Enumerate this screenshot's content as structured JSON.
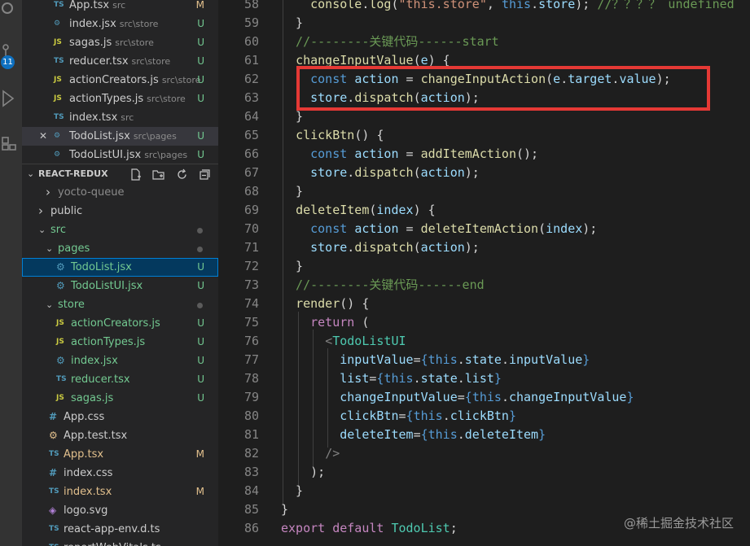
{
  "explorer": {
    "open_editors": [
      {
        "type": "TS",
        "name": "App.tsx",
        "path": "src",
        "status": "M",
        "type_color": "#519aba"
      },
      {
        "type": "⚙",
        "name": "index.jsx",
        "path": "src\\store",
        "status": "U",
        "type_color": "#519aba"
      },
      {
        "type": "JS",
        "name": "sagas.js",
        "path": "src\\store",
        "status": "U",
        "type_color": "#cbcb41"
      },
      {
        "type": "TS",
        "name": "reducer.tsx",
        "path": "src\\store",
        "status": "U",
        "type_color": "#519aba"
      },
      {
        "type": "JS",
        "name": "actionCreators.js",
        "path": "src\\store",
        "status": "U",
        "type_color": "#cbcb41"
      },
      {
        "type": "JS",
        "name": "actionTypes.js",
        "path": "src\\store",
        "status": "U",
        "type_color": "#cbcb41"
      },
      {
        "type": "TS",
        "name": "index.tsx",
        "path": "src",
        "status": "",
        "type_color": "#519aba"
      },
      {
        "type": "⚙",
        "name": "TodoList.jsx",
        "path": "src\\pages",
        "status": "U",
        "type_color": "#519aba",
        "close": "✕"
      },
      {
        "type": "⚙",
        "name": "TodoListUI.jsx",
        "path": "src\\pages",
        "status": "U",
        "type_color": "#519aba"
      }
    ],
    "section_title": "REACT-REDUX",
    "tree": [
      {
        "depth": 1,
        "chev": "›",
        "type": "",
        "name": "yocto-queue",
        "status": "",
        "dim": true
      },
      {
        "depth": 0,
        "chev": "›",
        "type": "",
        "name": "public",
        "status": ""
      },
      {
        "depth": 0,
        "chev": "⌄",
        "type": "",
        "name": "src",
        "status": "dot",
        "dot_color": "#73c991"
      },
      {
        "depth": 1,
        "chev": "⌄",
        "type": "",
        "name": "pages",
        "status": "dot",
        "dot_color": "#73c991"
      },
      {
        "depth": 2,
        "type": "⚙",
        "name": "TodoList.jsx",
        "status": "U",
        "selected": true,
        "type_color": "#519aba"
      },
      {
        "depth": 2,
        "type": "⚙",
        "name": "TodoListUI.jsx",
        "status": "U",
        "type_color": "#519aba"
      },
      {
        "depth": 1,
        "chev": "⌄",
        "type": "",
        "name": "store",
        "status": "dot",
        "dot_color": "#73c991"
      },
      {
        "depth": 2,
        "type": "JS",
        "name": "actionCreators.js",
        "status": "U",
        "type_color": "#cbcb41"
      },
      {
        "depth": 2,
        "type": "JS",
        "name": "actionTypes.js",
        "status": "U",
        "type_color": "#cbcb41"
      },
      {
        "depth": 2,
        "type": "⚙",
        "name": "index.jsx",
        "status": "U",
        "type_color": "#519aba"
      },
      {
        "depth": 2,
        "type": "TS",
        "name": "reducer.tsx",
        "status": "U",
        "type_color": "#519aba"
      },
      {
        "depth": 2,
        "type": "JS",
        "name": "sagas.js",
        "status": "U",
        "type_color": "#cbcb41"
      },
      {
        "depth": 1,
        "type": "#",
        "name": "App.css",
        "status": "",
        "type_color": "#519aba"
      },
      {
        "depth": 1,
        "type": "⚙",
        "name": "App.test.tsx",
        "status": "",
        "type_color": "#e2c08d"
      },
      {
        "depth": 1,
        "type": "TS",
        "name": "App.tsx",
        "status": "M",
        "type_color": "#519aba"
      },
      {
        "depth": 1,
        "type": "#",
        "name": "index.css",
        "status": "",
        "type_color": "#519aba"
      },
      {
        "depth": 1,
        "type": "TS",
        "name": "index.tsx",
        "status": "M",
        "type_color": "#519aba"
      },
      {
        "depth": 1,
        "type": "◈",
        "name": "logo.svg",
        "status": "",
        "type_color": "#b180d7"
      },
      {
        "depth": 1,
        "type": "TS",
        "name": "react-app-env.d.ts",
        "status": "",
        "type_color": "#519aba"
      },
      {
        "depth": 1,
        "type": "TS",
        "name": "reportWebVitals.ts",
        "status": "",
        "type_color": "#519aba"
      }
    ],
    "activity_badge": "11"
  },
  "editor": {
    "lines": [
      {
        "n": "58",
        "tokens": [
          [
            "    ",
            "p"
          ],
          [
            "console",
            "y"
          ],
          [
            ".",
            "p"
          ],
          [
            "log",
            "y"
          ],
          [
            "(",
            "p"
          ],
          [
            "\"this.store\"",
            "s"
          ],
          [
            ", ",
            "p"
          ],
          [
            "this",
            "k"
          ],
          [
            ".",
            "p"
          ],
          [
            "store",
            "v"
          ],
          [
            "); ",
            "p"
          ],
          [
            "//？？？？ undefined",
            "c"
          ]
        ]
      },
      {
        "n": "59",
        "tokens": [
          [
            "  }",
            "p"
          ]
        ]
      },
      {
        "n": "60",
        "tokens": [
          [
            "  //--------关键代码------start",
            "c"
          ]
        ]
      },
      {
        "n": "61",
        "tokens": [
          [
            "  ",
            "p"
          ],
          [
            "changeInputValue",
            "y"
          ],
          [
            "(",
            "p"
          ],
          [
            "e",
            "v"
          ],
          [
            ") {",
            "p"
          ]
        ]
      },
      {
        "n": "62",
        "tokens": [
          [
            "    ",
            "p"
          ],
          [
            "const ",
            "k"
          ],
          [
            "action",
            "v"
          ],
          [
            " = ",
            "p"
          ],
          [
            "changeInputAction",
            "y"
          ],
          [
            "(",
            "p"
          ],
          [
            "e",
            "v"
          ],
          [
            ".",
            "p"
          ],
          [
            "target",
            "v"
          ],
          [
            ".",
            "p"
          ],
          [
            "value",
            "v"
          ],
          [
            ");",
            "p"
          ]
        ]
      },
      {
        "n": "63",
        "tokens": [
          [
            "    ",
            "p"
          ],
          [
            "store",
            "v"
          ],
          [
            ".",
            "p"
          ],
          [
            "dispatch",
            "y"
          ],
          [
            "(",
            "p"
          ],
          [
            "action",
            "v"
          ],
          [
            ");",
            "p"
          ]
        ]
      },
      {
        "n": "64",
        "tokens": [
          [
            "  }",
            "p"
          ]
        ]
      },
      {
        "n": "65",
        "tokens": [
          [
            "  ",
            "p"
          ],
          [
            "clickBtn",
            "y"
          ],
          [
            "() {",
            "p"
          ]
        ]
      },
      {
        "n": "66",
        "tokens": [
          [
            "    ",
            "p"
          ],
          [
            "const ",
            "k"
          ],
          [
            "action",
            "v"
          ],
          [
            " = ",
            "p"
          ],
          [
            "addItemAction",
            "y"
          ],
          [
            "();",
            "p"
          ]
        ]
      },
      {
        "n": "67",
        "tokens": [
          [
            "    ",
            "p"
          ],
          [
            "store",
            "v"
          ],
          [
            ".",
            "p"
          ],
          [
            "dispatch",
            "y"
          ],
          [
            "(",
            "p"
          ],
          [
            "action",
            "v"
          ],
          [
            ");",
            "p"
          ]
        ]
      },
      {
        "n": "68",
        "tokens": [
          [
            "  }",
            "p"
          ]
        ]
      },
      {
        "n": "69",
        "tokens": [
          [
            "  ",
            "p"
          ],
          [
            "deleteItem",
            "y"
          ],
          [
            "(",
            "p"
          ],
          [
            "index",
            "v"
          ],
          [
            ") {",
            "p"
          ]
        ]
      },
      {
        "n": "70",
        "tokens": [
          [
            "    ",
            "p"
          ],
          [
            "const ",
            "k"
          ],
          [
            "action",
            "v"
          ],
          [
            " = ",
            "p"
          ],
          [
            "deleteItemAction",
            "y"
          ],
          [
            "(",
            "p"
          ],
          [
            "index",
            "v"
          ],
          [
            ");",
            "p"
          ]
        ]
      },
      {
        "n": "71",
        "tokens": [
          [
            "    ",
            "p"
          ],
          [
            "store",
            "v"
          ],
          [
            ".",
            "p"
          ],
          [
            "dispatch",
            "y"
          ],
          [
            "(",
            "p"
          ],
          [
            "action",
            "v"
          ],
          [
            ");",
            "p"
          ]
        ]
      },
      {
        "n": "72",
        "tokens": [
          [
            "  }",
            "p"
          ]
        ]
      },
      {
        "n": "73",
        "tokens": [
          [
            "  //--------关键代码------end",
            "c"
          ]
        ]
      },
      {
        "n": "74",
        "tokens": [
          [
            "  ",
            "p"
          ],
          [
            "render",
            "y"
          ],
          [
            "() {",
            "p"
          ]
        ]
      },
      {
        "n": "75",
        "tokens": [
          [
            "    ",
            "p"
          ],
          [
            "return ",
            "m"
          ],
          [
            "(",
            "p"
          ]
        ]
      },
      {
        "n": "76",
        "tokens": [
          [
            "      ",
            "p"
          ],
          [
            "<",
            "g"
          ],
          [
            "TodoListUI",
            "t"
          ]
        ]
      },
      {
        "n": "77",
        "tokens": [
          [
            "        ",
            "p"
          ],
          [
            "inputValue",
            "v"
          ],
          [
            "=",
            "p"
          ],
          [
            "{",
            "k"
          ],
          [
            "this",
            "k"
          ],
          [
            ".",
            "p"
          ],
          [
            "state",
            "v"
          ],
          [
            ".",
            "p"
          ],
          [
            "inputValue",
            "v"
          ],
          [
            "}",
            "k"
          ]
        ]
      },
      {
        "n": "78",
        "tokens": [
          [
            "        ",
            "p"
          ],
          [
            "list",
            "v"
          ],
          [
            "=",
            "p"
          ],
          [
            "{",
            "k"
          ],
          [
            "this",
            "k"
          ],
          [
            ".",
            "p"
          ],
          [
            "state",
            "v"
          ],
          [
            ".",
            "p"
          ],
          [
            "list",
            "v"
          ],
          [
            "}",
            "k"
          ]
        ]
      },
      {
        "n": "79",
        "tokens": [
          [
            "        ",
            "p"
          ],
          [
            "changeInputValue",
            "v"
          ],
          [
            "=",
            "p"
          ],
          [
            "{",
            "k"
          ],
          [
            "this",
            "k"
          ],
          [
            ".",
            "p"
          ],
          [
            "changeInputValue",
            "v"
          ],
          [
            "}",
            "k"
          ]
        ]
      },
      {
        "n": "80",
        "tokens": [
          [
            "        ",
            "p"
          ],
          [
            "clickBtn",
            "v"
          ],
          [
            "=",
            "p"
          ],
          [
            "{",
            "k"
          ],
          [
            "this",
            "k"
          ],
          [
            ".",
            "p"
          ],
          [
            "clickBtn",
            "v"
          ],
          [
            "}",
            "k"
          ]
        ]
      },
      {
        "n": "81",
        "tokens": [
          [
            "        ",
            "p"
          ],
          [
            "deleteItem",
            "v"
          ],
          [
            "=",
            "p"
          ],
          [
            "{",
            "k"
          ],
          [
            "this",
            "k"
          ],
          [
            ".",
            "p"
          ],
          [
            "deleteItem",
            "v"
          ],
          [
            "}",
            "k"
          ]
        ]
      },
      {
        "n": "82",
        "tokens": [
          [
            "      ",
            "p"
          ],
          [
            "/>",
            "g"
          ]
        ]
      },
      {
        "n": "83",
        "tokens": [
          [
            "    );",
            "p"
          ]
        ]
      },
      {
        "n": "84",
        "tokens": [
          [
            "  }",
            "p"
          ]
        ]
      },
      {
        "n": "85",
        "tokens": [
          [
            "}",
            "p"
          ]
        ]
      },
      {
        "n": "86",
        "tokens": [
          [
            "export ",
            "m"
          ],
          [
            "default ",
            "m"
          ],
          [
            "TodoList",
            "t"
          ],
          [
            ";",
            "p"
          ]
        ]
      }
    ],
    "token_colors": {
      "p": "#d4d4d4",
      "y": "#dcdcaa",
      "s": "#ce9178",
      "k": "#569cd6",
      "v": "#9cdcfe",
      "c": "#6a9955",
      "m": "#c586c0",
      "t": "#4ec9b0",
      "g": "#808080"
    }
  },
  "watermark": "@稀土掘金技术社区",
  "colors": {
    "status_M": "#e2c08d",
    "status_U": "#73c991",
    "highlight_box": "#e53935"
  }
}
